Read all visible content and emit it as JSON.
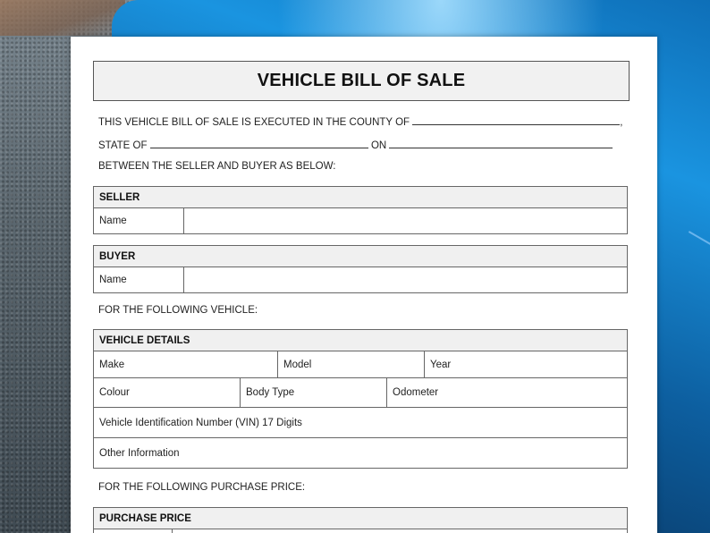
{
  "document": {
    "title": "VEHICLE BILL OF SALE",
    "intro_line1_prefix": "THIS VEHICLE BILL OF SALE IS EXECUTED IN THE COUNTY OF",
    "intro_line1_suffix": ",",
    "intro_line2_state": "STATE OF",
    "intro_line2_on": "ON",
    "intro_line3": "BETWEEN THE SELLER AND BUYER AS BELOW:",
    "vehicle_intro": "FOR THE FOLLOWING VEHICLE:",
    "price_intro": "FOR THE FOLLOWING PURCHASE PRICE:"
  },
  "seller": {
    "heading": "SELLER",
    "name_label": "Name",
    "name_value": ""
  },
  "buyer": {
    "heading": "BUYER",
    "name_label": "Name",
    "name_value": ""
  },
  "vehicle_details": {
    "heading": "VEHICLE DETAILS",
    "make_label": "Make",
    "model_label": "Model",
    "year_label": "Year",
    "colour_label": "Colour",
    "body_type_label": "Body Type",
    "odometer_label": "Odometer",
    "vin_label": "Vehicle Identification Number (VIN) 17 Digits",
    "other_label": "Other Information"
  },
  "purchase_price": {
    "heading": "PURCHASE PRICE"
  }
}
